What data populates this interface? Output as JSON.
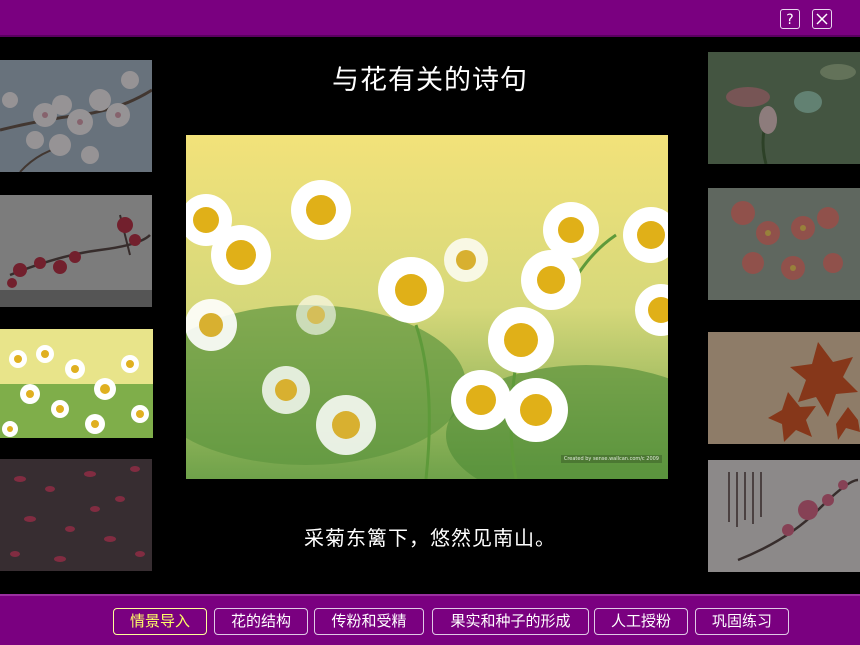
{
  "window": {
    "help_label": "?",
    "close_icon": "close-icon"
  },
  "slide": {
    "title": "与花有关的诗句",
    "caption": "采菊东篱下，悠然见南山。",
    "photo_watermark": "Created by sense.wallcan.com/c 2009"
  },
  "left_thumbnails": [
    {
      "name": "white-blossom",
      "selected": false
    },
    {
      "name": "red-plum",
      "selected": false
    },
    {
      "name": "daisies",
      "selected": true
    },
    {
      "name": "petals",
      "selected": false
    }
  ],
  "right_thumbnails": [
    {
      "name": "lotus-bud",
      "selected": false
    },
    {
      "name": "pink-flowers",
      "selected": false
    },
    {
      "name": "autumn-leaves",
      "selected": false
    },
    {
      "name": "plum-with-calligraphy",
      "selected": false
    }
  ],
  "nav": {
    "items": [
      "情景导入",
      "花的结构",
      "传粉和受精",
      "果实和种子的形成",
      "人工授粉",
      "巩固练习"
    ],
    "active_index": 0
  },
  "colors": {
    "bar_purple": "#7a0080",
    "active_text": "#ffff66"
  }
}
